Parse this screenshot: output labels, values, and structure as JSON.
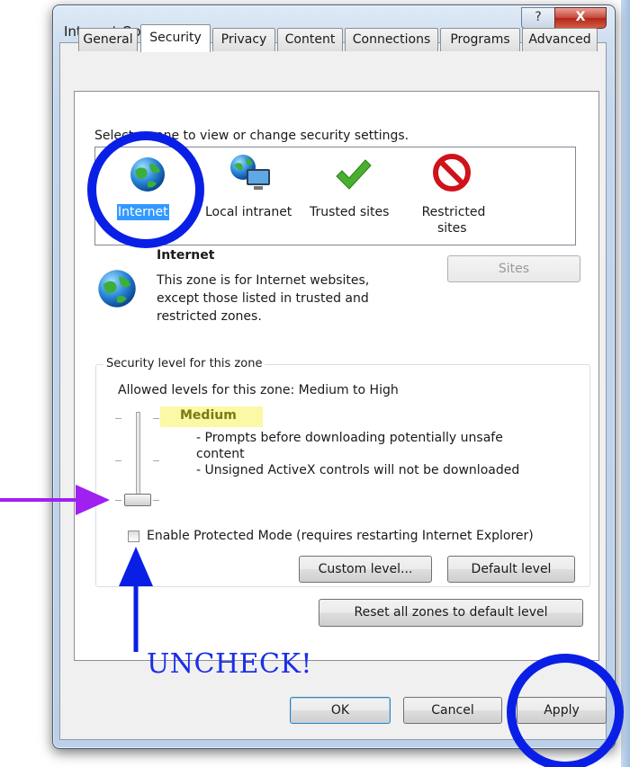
{
  "window": {
    "title": "Internet Options",
    "help_glyph": "?",
    "close_glyph": "X"
  },
  "tabs": [
    "General",
    "Security",
    "Privacy",
    "Content",
    "Connections",
    "Programs",
    "Advanced"
  ],
  "active_tab": "Security",
  "zones": {
    "prompt": "Select a zone to view or change security settings.",
    "items": [
      {
        "label": "Internet",
        "icon": "globe-icon",
        "selected": true
      },
      {
        "label": "Local intranet",
        "icon": "intranet-icon",
        "selected": false
      },
      {
        "label": "Trusted sites",
        "icon": "checkmark-icon",
        "selected": false
      },
      {
        "label": "Restricted",
        "label2": "sites",
        "icon": "restricted-icon",
        "selected": false
      }
    ]
  },
  "zone_info": {
    "name": "Internet",
    "desc1": "This zone is for Internet websites,",
    "desc2": "except those listed in trusted and",
    "desc3": "restricted zones.",
    "sites_button": "Sites"
  },
  "security_level": {
    "legend": "Security level for this zone",
    "allowed": "Allowed levels for this zone: Medium to High",
    "level_name": "Medium",
    "line1": "- Prompts before downloading potentially unsafe",
    "line2": "content",
    "line3": "- Unsigned ActiveX controls will not be downloaded",
    "slider_level": "Medium"
  },
  "protected_mode": {
    "label": "Enable Protected Mode (requires restarting Internet Explorer)",
    "checked": false
  },
  "buttons": {
    "custom_level": "Custom level...",
    "default_level": "Default level",
    "reset_all": "Reset all zones to default level",
    "ok": "OK",
    "cancel": "Cancel",
    "apply": "Apply"
  },
  "annotations": {
    "uncheck_text": "UNCHECK!",
    "circle_color": "#0a1fe6",
    "arrow_color": "#a020f0"
  }
}
